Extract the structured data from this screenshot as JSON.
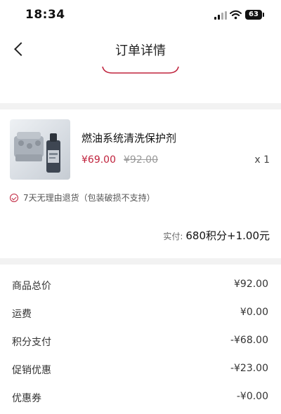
{
  "status_bar": {
    "time": "18:34",
    "battery": "63"
  },
  "nav": {
    "title": "订单详情"
  },
  "colors": {
    "accent": "#c0233d",
    "divider": "#f2f2f2"
  },
  "product": {
    "image_icon": "engine-and-bottle-image",
    "name": "燃油系统清洗保护剂",
    "price_current": "¥69.00",
    "price_original": "¥92.00",
    "quantity": "x 1",
    "return_policy": "7天无理由退货（包装破损不支持）"
  },
  "payment": {
    "label": "实付:",
    "value": "680积分+1.00元"
  },
  "summary": [
    {
      "label": "商品总价",
      "value": "¥92.00"
    },
    {
      "label": "运费",
      "value": "¥0.00"
    },
    {
      "label": "积分支付",
      "value": "-¥68.00"
    },
    {
      "label": "促销优惠",
      "value": "-¥23.00"
    },
    {
      "label": "优惠券",
      "value": "-¥0.00"
    }
  ]
}
